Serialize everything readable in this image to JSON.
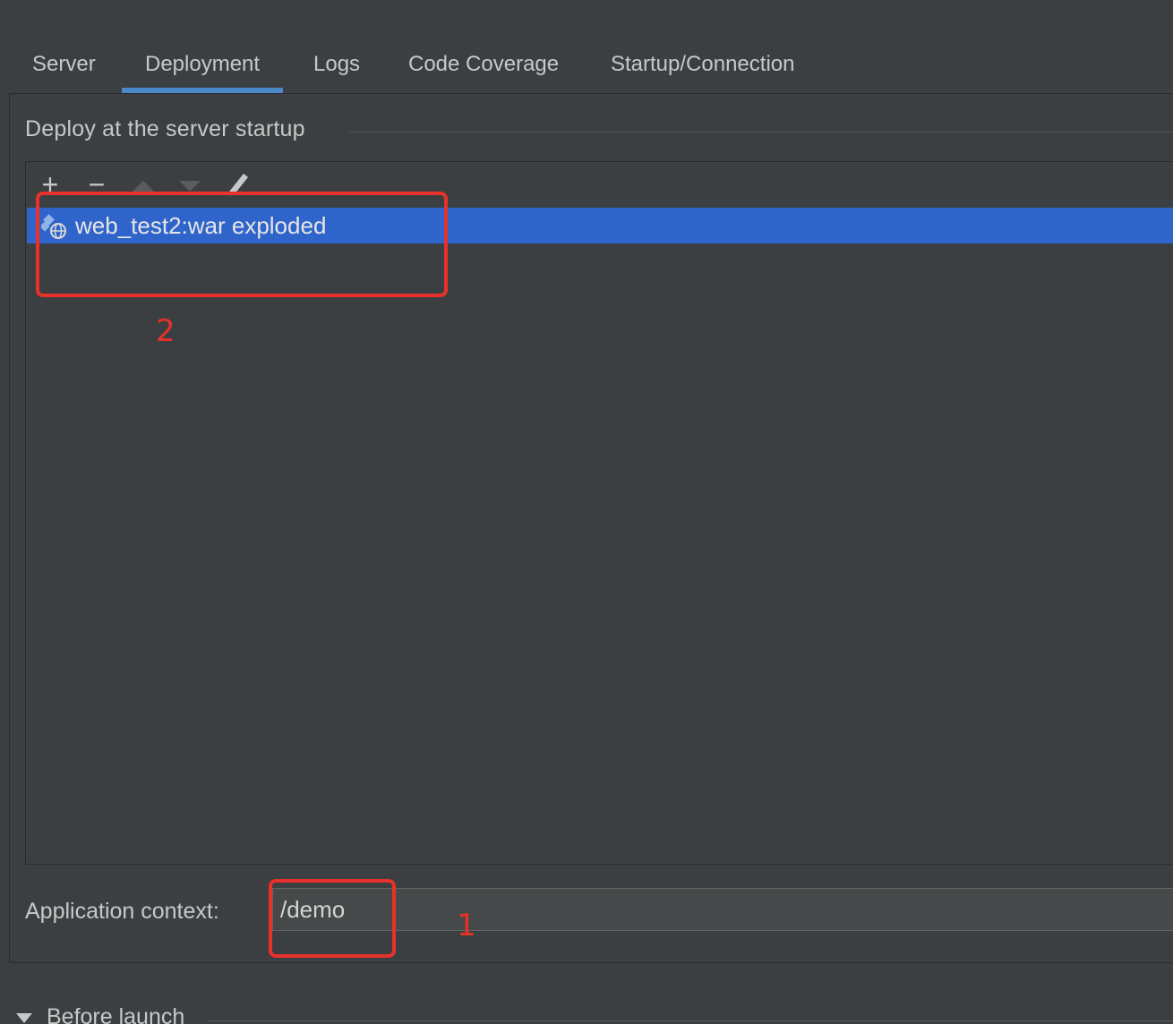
{
  "tabs": [
    {
      "label": "Server"
    },
    {
      "label": "Deployment",
      "active": true
    },
    {
      "label": "Logs"
    },
    {
      "label": "Code Coverage"
    },
    {
      "label": "Startup/Connection"
    }
  ],
  "deployment": {
    "section_title": "Deploy at the server startup",
    "toolbar": {
      "add": "+",
      "remove": "−",
      "move_up_icon": "triangle-up-icon",
      "move_down_icon": "triangle-down-icon",
      "edit_icon": "pencil-icon"
    },
    "artifacts": [
      {
        "label": "web_test2:war exploded",
        "icon": "web-artifact-icon",
        "selected": true
      }
    ],
    "app_context_label": "Application context:",
    "app_context_value": "/demo"
  },
  "annotations": {
    "marker_1": "1",
    "marker_2": "2",
    "color": "#e8312a"
  },
  "before_launch": {
    "label": "Before launch"
  },
  "colors": {
    "background": "#3c3f41",
    "selection": "#2f65ca",
    "tab_underline": "#4a88c7"
  }
}
